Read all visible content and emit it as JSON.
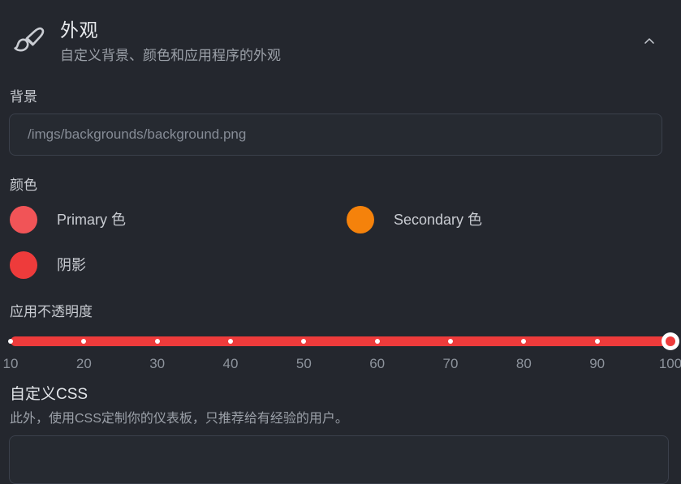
{
  "header": {
    "icon": "paintbrush-icon",
    "title": "外观",
    "subtitle": "自定义背景、颜色和应用程序的外观",
    "collapse_icon": "chevron-up-icon"
  },
  "background": {
    "label": "背景",
    "value": "",
    "placeholder": "/imgs/backgrounds/background.png"
  },
  "colors": {
    "label": "颜色",
    "items": [
      {
        "name": "Primary 色",
        "hex": "#f15457"
      },
      {
        "name": "Secondary 色",
        "hex": "#f5820b"
      },
      {
        "name": "阴影",
        "hex": "#ee3b3b"
      }
    ]
  },
  "opacity": {
    "label": "应用不透明度",
    "value": 100,
    "min": 10,
    "max": 100,
    "step": 10,
    "track_color": "#ee3b3b",
    "ticks": [
      10,
      20,
      30,
      40,
      50,
      60,
      70,
      80,
      90,
      100
    ]
  },
  "custom_css": {
    "title": "自定义CSS",
    "description": "此外，使用CSS定制你的仪表板，只推荐给有经验的用户。",
    "value": "",
    "placeholder": ""
  }
}
